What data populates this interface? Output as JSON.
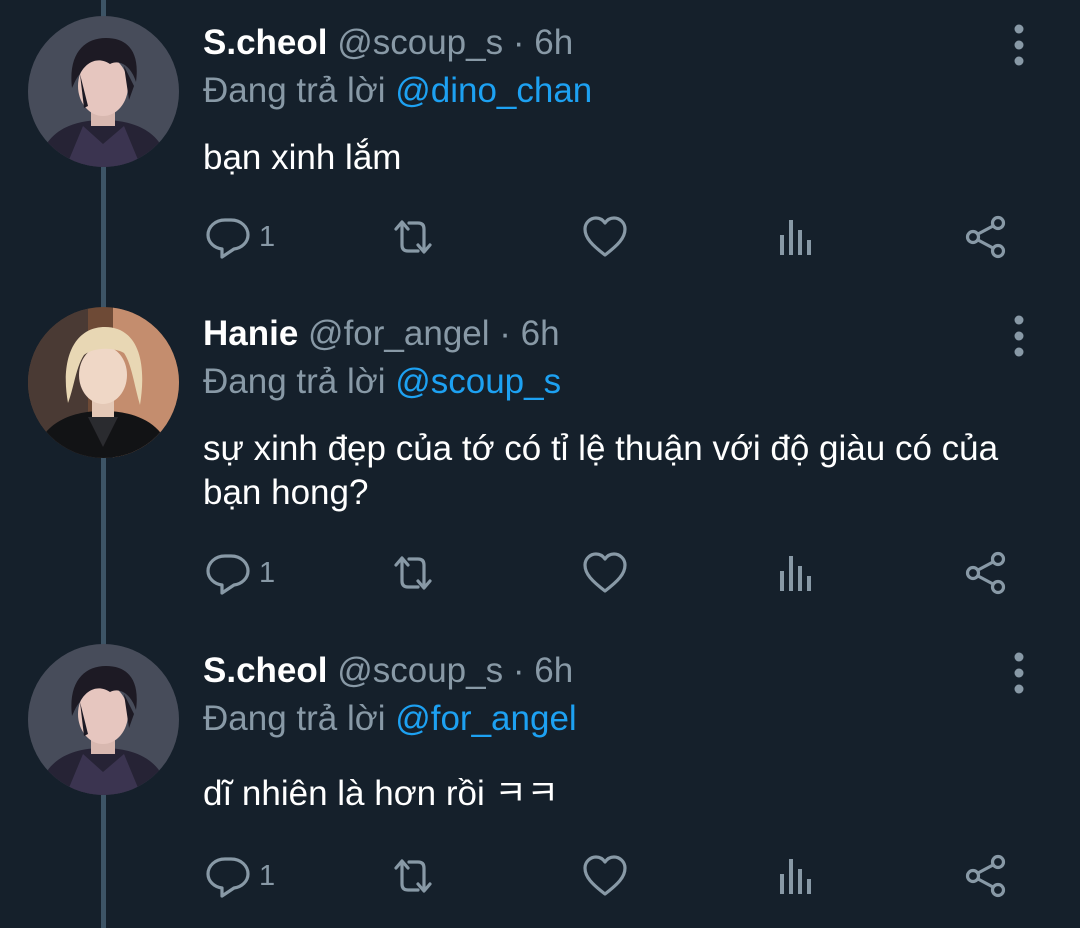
{
  "tweets": [
    {
      "name": "S.cheol",
      "handle": "@scoup_s",
      "separator": "·",
      "time": "6h",
      "reply_prefix": "Đang trả lời",
      "reply_to": "@dino_chan",
      "text": "bạn xinh lắm",
      "reply_count": "1",
      "avatar": "dark-hair-man-avatar"
    },
    {
      "name": "Hanie",
      "handle": "@for_angel",
      "separator": "·",
      "time": "6h",
      "reply_prefix": "Đang trả lời",
      "reply_to": "@scoup_s",
      "text": "sự xinh đẹp của tớ có tỉ lệ thuận với độ giàu có của bạn hong?",
      "reply_count": "1",
      "avatar": "blonde-hair-man-avatar"
    },
    {
      "name": "S.cheol",
      "handle": "@scoup_s",
      "separator": "·",
      "time": "6h",
      "reply_prefix": "Đang trả lời",
      "reply_to": "@for_angel",
      "text": "dĩ nhiên là hơn rồi ㅋㅋ",
      "reply_count": "1",
      "avatar": "dark-hair-man-avatar"
    }
  ],
  "icons": {
    "reply": "reply-icon",
    "retweet": "retweet-icon",
    "like": "heart-icon",
    "analytics": "analytics-icon",
    "share": "share-icon",
    "more": "more-vertical-icon"
  },
  "colors": {
    "background": "#15202b",
    "name": "#ffffff",
    "muted": "#8899a6",
    "mention": "#1da1f2",
    "thread_line": "#3d5466"
  }
}
